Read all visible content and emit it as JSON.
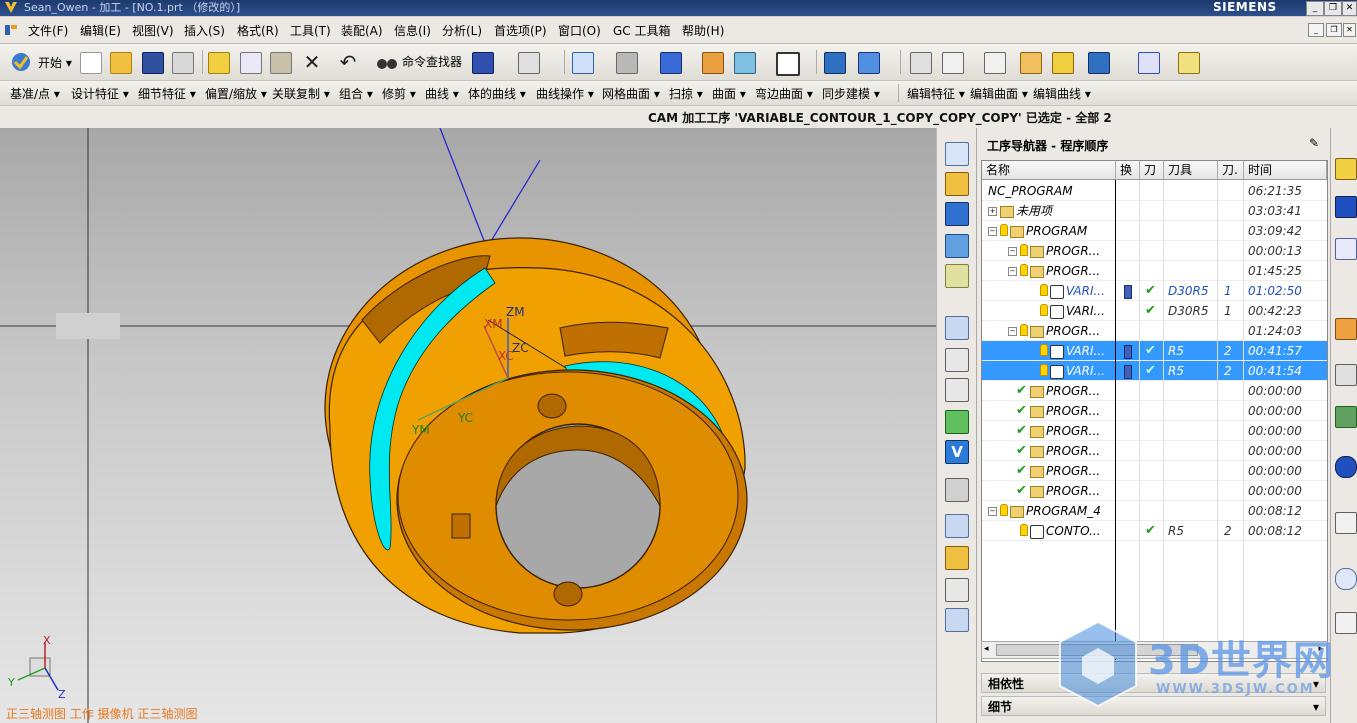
{
  "window": {
    "title": "Sean_Owen - 加工 - [NO.1.prt （修改的）]",
    "brand": "SIEMENS"
  },
  "menubar": {
    "items": [
      "文件(F)",
      "编辑(E)",
      "视图(V)",
      "插入(S)",
      "格式(R)",
      "工具(T)",
      "装配(A)",
      "信息(I)",
      "分析(L)",
      "首选项(P)",
      "窗口(O)",
      "GC 工具箱",
      "帮助(H)"
    ]
  },
  "toolbar1": {
    "start_label": "开始 ▾",
    "command_finder_label": "命令查找器"
  },
  "toolbar2": {
    "items": [
      "基准/点 ▾",
      "设计特征 ▾",
      "细节特征 ▾",
      "偏置/缩放 ▾",
      "关联复制 ▾",
      "组合 ▾",
      "修剪 ▾",
      "曲线 ▾",
      "体的曲线 ▾",
      "曲线操作 ▾",
      "网格曲面 ▾",
      "扫掠 ▾",
      "曲面 ▾",
      "弯边曲面 ▾",
      "同步建模 ▾",
      "编辑特征 ▾",
      "编辑曲面 ▾",
      "编辑曲线 ▾"
    ]
  },
  "status": {
    "cam_message": "CAM 加工工序 'VARIABLE_CONTOUR_1_COPY_COPY_COPY' 已选定 - 全部 2"
  },
  "viewport": {
    "view_label": "正三轴测图  工作 摄像机 正三轴测图",
    "axis_labels": {
      "zm": "ZM",
      "zc": "ZC",
      "xm": "XM",
      "xc": "XC",
      "ym": "YM",
      "yc": "YC"
    },
    "triad": {
      "x": "X",
      "y": "Y",
      "z": "Z"
    }
  },
  "navigator": {
    "title": "工序导航器 - 程序顺序",
    "columns": [
      "名称",
      "换",
      "刀",
      "刀具",
      "刀.",
      "时间"
    ],
    "rows": [
      {
        "name": "NC_PROGRAM",
        "tool": "",
        "num": "",
        "time": "06:21:35",
        "level": 0,
        "kind": "root",
        "check": false,
        "sel": false
      },
      {
        "name": "未用项",
        "tool": "",
        "num": "",
        "time": "03:03:41",
        "level": 0,
        "kind": "folder",
        "check": false,
        "sel": false
      },
      {
        "name": "PROGRAM",
        "tool": "",
        "num": "",
        "time": "03:09:42",
        "level": 0,
        "kind": "prog",
        "check": false,
        "sel": false
      },
      {
        "name": "PROGR...",
        "tool": "",
        "num": "",
        "time": "00:00:13",
        "level": 1,
        "kind": "prog",
        "check": false,
        "sel": false
      },
      {
        "name": "PROGR...",
        "tool": "",
        "num": "",
        "time": "01:45:25",
        "level": 1,
        "kind": "prog",
        "check": false,
        "sel": false
      },
      {
        "name": "VARI...",
        "tool": "D30R5",
        "num": "1",
        "time": "01:02:50",
        "level": 2,
        "kind": "op",
        "check": true,
        "sel": false,
        "blue": true
      },
      {
        "name": "VARI...",
        "tool": "D30R5",
        "num": "1",
        "time": "00:42:23",
        "level": 2,
        "kind": "op",
        "check": true,
        "sel": false
      },
      {
        "name": "PROGR...",
        "tool": "",
        "num": "",
        "time": "01:24:03",
        "level": 1,
        "kind": "prog",
        "check": false,
        "sel": false
      },
      {
        "name": "VARI...",
        "tool": "R5",
        "num": "2",
        "time": "00:41:57",
        "level": 2,
        "kind": "op",
        "check": true,
        "sel": true
      },
      {
        "name": "VARI...",
        "tool": "R5",
        "num": "2",
        "time": "00:41:54",
        "level": 2,
        "kind": "op",
        "check": true,
        "sel": true
      },
      {
        "name": "PROGR...",
        "tool": "",
        "num": "",
        "time": "00:00:00",
        "level": 1,
        "kind": "progchk",
        "check": false,
        "sel": false
      },
      {
        "name": "PROGR...",
        "tool": "",
        "num": "",
        "time": "00:00:00",
        "level": 1,
        "kind": "progchk",
        "check": false,
        "sel": false
      },
      {
        "name": "PROGR...",
        "tool": "",
        "num": "",
        "time": "00:00:00",
        "level": 1,
        "kind": "progchk",
        "check": false,
        "sel": false
      },
      {
        "name": "PROGR...",
        "tool": "",
        "num": "",
        "time": "00:00:00",
        "level": 1,
        "kind": "progchk",
        "check": false,
        "sel": false
      },
      {
        "name": "PROGR...",
        "tool": "",
        "num": "",
        "time": "00:00:00",
        "level": 1,
        "kind": "progchk",
        "check": false,
        "sel": false
      },
      {
        "name": "PROGR...",
        "tool": "",
        "num": "",
        "time": "00:00:00",
        "level": 1,
        "kind": "progchk",
        "check": false,
        "sel": false
      },
      {
        "name": "PROGRAM_4",
        "tool": "",
        "num": "",
        "time": "00:08:12",
        "level": 0,
        "kind": "prog",
        "check": false,
        "sel": false
      },
      {
        "name": "CONTO...",
        "tool": "R5",
        "num": "2",
        "time": "00:08:12",
        "level": 1,
        "kind": "op",
        "check": true,
        "sel": false
      }
    ],
    "sections": [
      "相依性",
      "细节"
    ]
  },
  "watermark": {
    "title": "3D世界网",
    "url": "WWW.3DSJW.COM"
  },
  "colors": {
    "part_orange": "#f0a000",
    "part_dark": "#b06800",
    "toolpath_cyan": "#00e8f0",
    "selection_blue": "#3399ff",
    "view_label_orange": "#e87820"
  }
}
